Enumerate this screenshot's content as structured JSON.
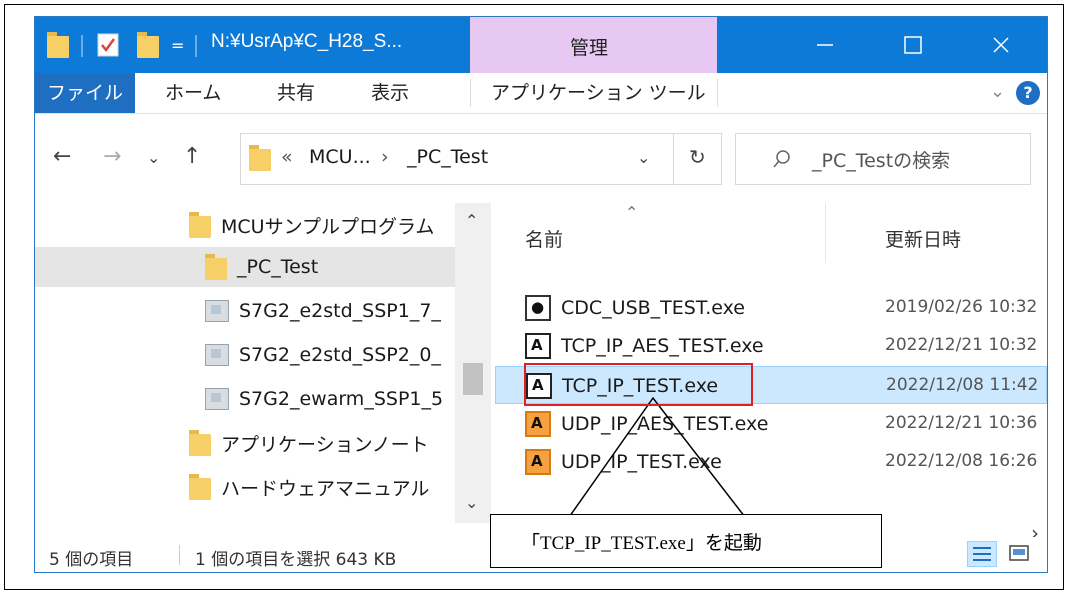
{
  "titlebar": {
    "path": "N:¥UsrAp¥C_H28_S...",
    "context_tab": "管理",
    "quick_access_sep": "|",
    "dropdown_glyph": "=",
    "minimize": "—",
    "maximize": "☐",
    "close": "✕"
  },
  "ribbon": {
    "tabs": [
      "ファイル",
      "ホーム",
      "共有",
      "表示",
      "アプリケーション ツール"
    ],
    "expand_glyph": "⌄",
    "help_glyph": "?"
  },
  "address": {
    "back": "←",
    "forward": "→",
    "recent": "⌄",
    "up": "↑",
    "breadcrumb_overflow": "«",
    "crumb_parent": "MCU...",
    "crumb_sep": "›",
    "crumb_current": "_PC_Test",
    "dropdown": "⌄",
    "refresh": "↻",
    "search_placeholder": "_PC_Testの検索"
  },
  "nav_tree": [
    {
      "label": "MCUサンプルプログラム",
      "type": "folder"
    },
    {
      "label": "_PC_Test",
      "type": "folder",
      "selected": true
    },
    {
      "label": "S7G2_e2std_SSP1_7_",
      "type": "archive"
    },
    {
      "label": "S7G2_e2std_SSP2_0_",
      "type": "archive"
    },
    {
      "label": "S7G2_ewarm_SSP1_5",
      "type": "archive"
    },
    {
      "label": "アプリケーションノート",
      "type": "folder"
    },
    {
      "label": "ハードウェアマニュアル",
      "type": "folder"
    }
  ],
  "tree_scroll": {
    "up": "⌃",
    "down": "⌄"
  },
  "columns": {
    "name": "名前",
    "modified": "更新日時",
    "sort_glyph": "⌃"
  },
  "files": [
    {
      "name": "CDC_USB_TEST.exe",
      "modified": "2019/02/26 10:32",
      "icon": "usb-app-icon",
      "icon_glyph": "●"
    },
    {
      "name": "TCP_IP_AES_TEST.exe",
      "modified": "2022/12/21 10:32",
      "icon": "network-app-icon",
      "icon_glyph": "A"
    },
    {
      "name": "TCP_IP_TEST.exe",
      "modified": "2022/12/08 11:42",
      "icon": "network-app-icon",
      "icon_glyph": "A",
      "selected": true
    },
    {
      "name": "UDP_IP_AES_TEST.exe",
      "modified": "2022/12/21 10:36",
      "icon": "udp-app-icon",
      "icon_glyph": "A"
    },
    {
      "name": "UDP_IP_TEST.exe",
      "modified": "2022/12/08 16:26",
      "icon": "udp-app-icon",
      "icon_glyph": "A"
    }
  ],
  "hscroll": {
    "left": "‹",
    "right": "›"
  },
  "status": {
    "item_count": "5 個の項目",
    "selection": "1 個の項目を選択 643 KB"
  },
  "annotation": {
    "text": "「TCP_IP_TEST.exe」を起動"
  },
  "colors": {
    "titlebar": "#0c7ad6",
    "manage_tab": "#e6c8f2",
    "selection": "#cce8ff",
    "highlight": "#e02020"
  }
}
